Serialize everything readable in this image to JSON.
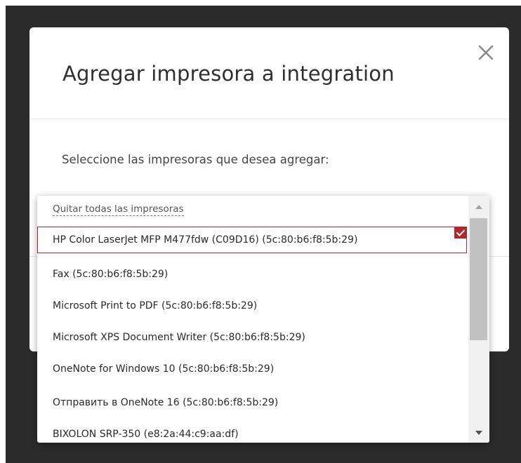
{
  "modal": {
    "title": "Agregar impresora a integration",
    "close_icon": "close-icon",
    "prompt": "Seleccione las impresoras que desea agregar:"
  },
  "dropdown": {
    "remove_all_label": "Quitar todas las impresoras",
    "options": [
      {
        "label": "HP Color LaserJet MFP M477fdw (C09D16) (5c:80:b6:f8:5b:29)",
        "selected": true
      },
      {
        "label": "Fax (5c:80:b6:f8:5b:29)",
        "selected": false
      },
      {
        "label": "Microsoft Print to PDF (5c:80:b6:f8:5b:29)",
        "selected": false
      },
      {
        "label": "Microsoft XPS Document Writer (5c:80:b6:f8:5b:29)",
        "selected": false
      },
      {
        "label": "OneNote for Windows 10 (5c:80:b6:f8:5b:29)",
        "selected": false
      },
      {
        "label": "Отправить в OneNote 16 (5c:80:b6:f8:5b:29)",
        "selected": false
      },
      {
        "label": "BIXOLON SRP-350 (e8:2a:44:c9:aa:df)",
        "selected": false
      }
    ]
  },
  "colors": {
    "accent": "#b1272d",
    "backdrop": "#2b2b2b",
    "title_text": "#2f2f2f"
  }
}
